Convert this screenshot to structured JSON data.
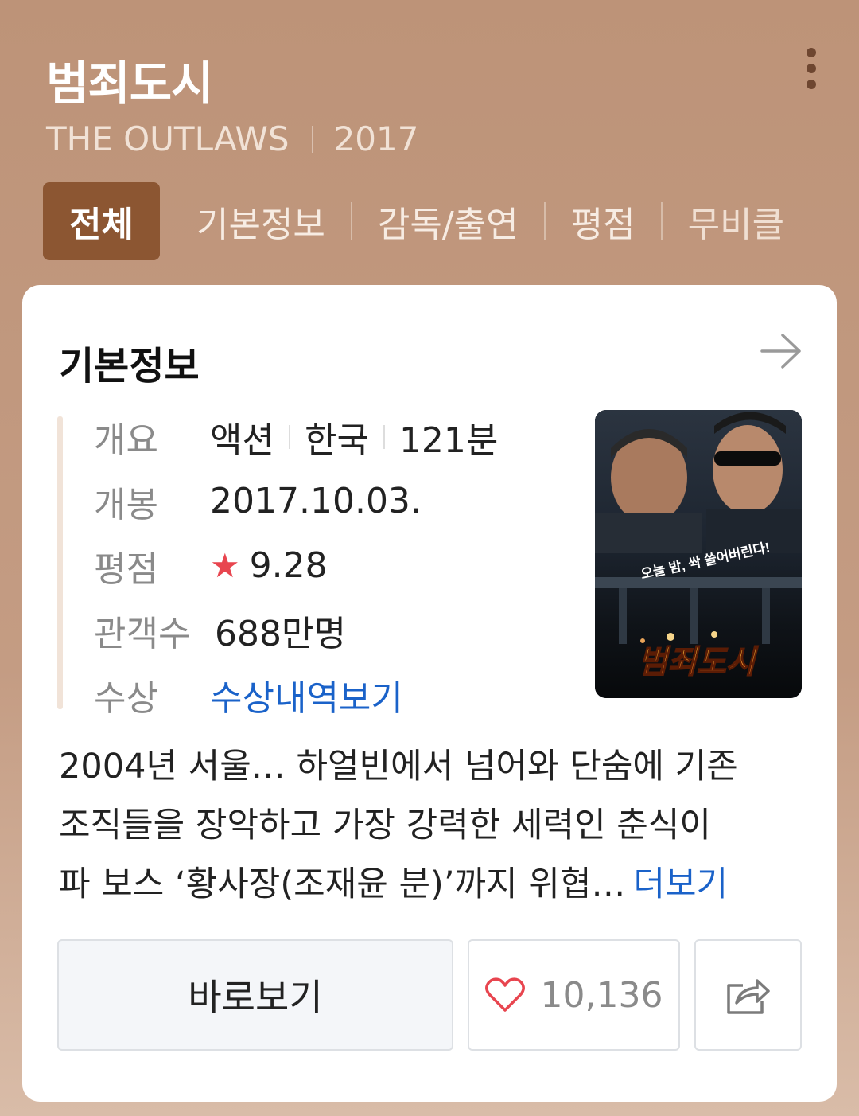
{
  "header": {
    "title": "범죄도시",
    "english_title": "THE OUTLAWS",
    "year": "2017",
    "more_icon": "more-vertical-icon"
  },
  "tabs": [
    {
      "label": "전체",
      "active": true
    },
    {
      "label": "기본정보",
      "active": false
    },
    {
      "label": "감독/출연",
      "active": false
    },
    {
      "label": "평점",
      "active": false
    },
    {
      "label": "무비클",
      "active": false
    }
  ],
  "card": {
    "title": "기본정보",
    "arrow_icon": "arrow-right-icon",
    "info": {
      "overview_label": "개요",
      "genre": "액션",
      "country": "한국",
      "runtime": "121분",
      "release_label": "개봉",
      "release_date": "2017.10.03.",
      "rating_label": "평점",
      "rating_star": "★",
      "rating_value": "9.28",
      "audience_label": "관객수",
      "audience_value": "688만명",
      "awards_label": "수상",
      "awards_link": "수상내역보기"
    },
    "poster": {
      "title": "범죄도시",
      "tagline": "오늘 밤, 싹 쓸어버린다!"
    },
    "synopsis": {
      "line1": "2004년 서울… 하얼빈에서 넘어와 단숨에 기존",
      "line2": "조직들을 장악하고 가장 강력한 세력인 춘식이",
      "line3": "파 보스 ‘황사장(조재윤 분)’까지 위협…",
      "more_label": "더보기"
    },
    "buttons": {
      "watch_label": "바로보기",
      "like_count": "10,136",
      "like_icon": "heart-icon",
      "share_icon": "share-icon"
    }
  },
  "colors": {
    "background": "#bd9378",
    "active_tab": "#8c5632",
    "link": "#1a62c9",
    "star": "#e8454f",
    "heart": "#e8454f"
  }
}
